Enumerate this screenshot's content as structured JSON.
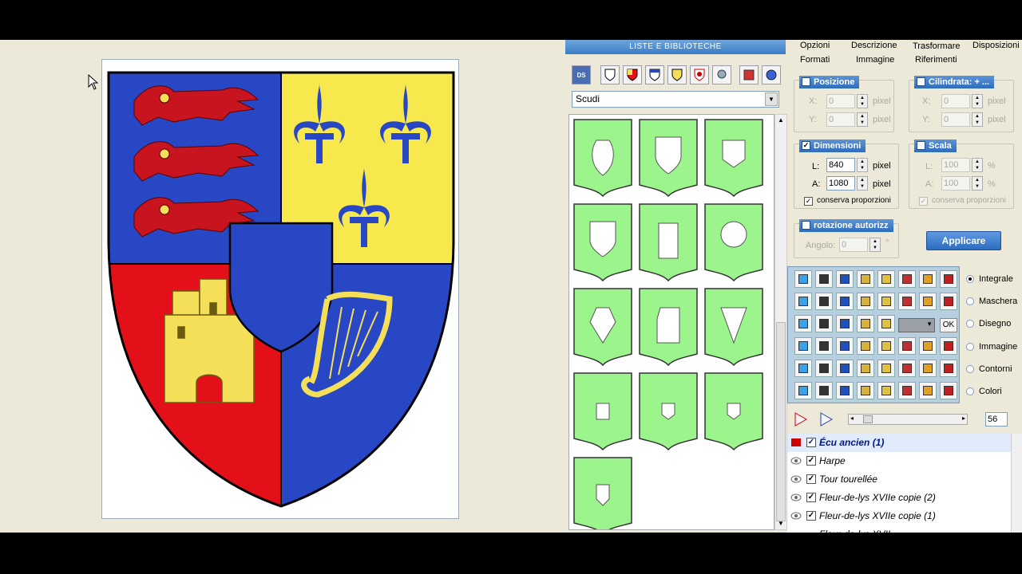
{
  "library": {
    "title": "LISTE E BIBLIOTECHE",
    "dropdown_value": "Scudi",
    "tool_icons": [
      "ds-logo-icon",
      "shield-plain-icon",
      "shield-quarterly-icon",
      "shield-chief-icon",
      "shield-yellow-icon",
      "shield-arms-icon",
      "helmet-icon",
      "gallery-icon",
      "circle-icon"
    ]
  },
  "tabs": {
    "row1": [
      "Opzioni",
      "Descrizione",
      "Trasformare",
      "Disposizioni"
    ],
    "row2": [
      "Formati",
      "Immagine",
      "Riferimenti"
    ]
  },
  "position": {
    "title": "Posizione",
    "x_label": "X:",
    "x_value": "0",
    "y_label": "Y:",
    "y_value": "0",
    "unit": "pixel"
  },
  "cylinder": {
    "title": "Cilindrata: + ...",
    "x_label": "X:",
    "x_value": "0",
    "y_label": "Y:",
    "y_value": "0",
    "unit": "pixel"
  },
  "dimensions": {
    "title": "Dimensioni",
    "l_label": "L:",
    "l_value": "840",
    "a_label": "A:",
    "a_value": "1080",
    "unit": "pixel",
    "keep_ratio": "conserva proporzioni",
    "check": "✓"
  },
  "scale": {
    "title": "Scala",
    "l_label": "L:",
    "l_value": "100",
    "a_label": "A:",
    "a_value": "100",
    "unit": "%",
    "keep_ratio": "conserva proporzioni",
    "check": "✓"
  },
  "rotation": {
    "title": "rotazione autorizz",
    "angle_label": "Angolo:",
    "angle_value": "0",
    "unit": "°"
  },
  "apply_label": "Applicare",
  "ok_label": "OK",
  "view_modes": [
    "Integrale",
    "Maschera",
    "Disegno",
    "Immagine",
    "Contorni",
    "Colori"
  ],
  "zoom_value": "56",
  "layers": [
    {
      "name": "Écu ancien (1)",
      "selected": true
    },
    {
      "name": "Harpe",
      "selected": false
    },
    {
      "name": "Tour tourellée",
      "selected": false
    },
    {
      "name": "Fleur-de-lys XVIIe copie (2)",
      "selected": false
    },
    {
      "name": "Fleur-de-lys XVIIe copie (1)",
      "selected": false
    },
    {
      "name": "Fleur-de-lys XVII...",
      "selected": false
    }
  ],
  "colors": {
    "blue": "#2747c4",
    "yellow": "#f7e84e",
    "red": "#e3101a",
    "gold": "#f6df58",
    "thumb_green": "#9cf58c"
  }
}
